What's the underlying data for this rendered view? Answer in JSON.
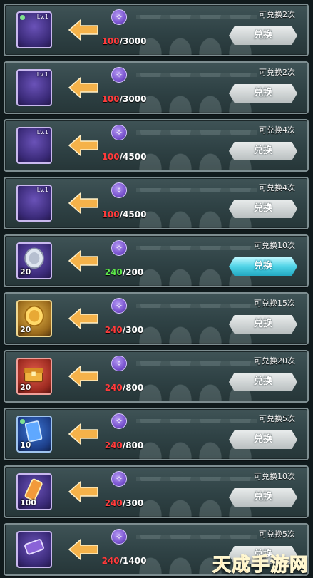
{
  "rows": [
    {
      "level": "Lv.1",
      "quantity": "",
      "have": "100",
      "need": "3000",
      "enough": false,
      "remaining": "可兑换2次",
      "button": "兑换",
      "active": false,
      "icon": "hero-portrait-icon",
      "color": "purple"
    },
    {
      "level": "Lv.1",
      "quantity": "",
      "have": "100",
      "need": "3000",
      "enough": false,
      "remaining": "可兑换2次",
      "button": "兑换",
      "active": false,
      "icon": "hero-portrait-icon",
      "color": "purple"
    },
    {
      "level": "Lv.1",
      "quantity": "",
      "have": "100",
      "need": "4500",
      "enough": false,
      "remaining": "可兑换4次",
      "button": "兑换",
      "active": false,
      "icon": "hero-portrait-icon",
      "color": "purple"
    },
    {
      "level": "Lv.1",
      "quantity": "",
      "have": "100",
      "need": "4500",
      "enough": false,
      "remaining": "可兑换4次",
      "button": "兑换",
      "active": false,
      "icon": "hero-portrait-icon",
      "color": "purple"
    },
    {
      "level": "",
      "quantity": "20",
      "have": "240",
      "need": "200",
      "enough": true,
      "remaining": "可兑换10次",
      "button": "兑换",
      "active": true,
      "icon": "silver-coin-icon",
      "color": "purple"
    },
    {
      "level": "",
      "quantity": "20",
      "have": "240",
      "need": "300",
      "enough": false,
      "remaining": "可兑换15次",
      "button": "兑换",
      "active": false,
      "icon": "gold-coin-icon",
      "color": "gold"
    },
    {
      "level": "",
      "quantity": "20",
      "have": "240",
      "need": "800",
      "enough": false,
      "remaining": "可兑换20次",
      "button": "兑换",
      "active": false,
      "icon": "treasure-chest-icon",
      "color": "red"
    },
    {
      "level": "",
      "quantity": "10",
      "have": "240",
      "need": "800",
      "enough": false,
      "remaining": "可兑换5次",
      "button": "兑换",
      "active": false,
      "icon": "blue-card-icon",
      "color": "blue"
    },
    {
      "level": "",
      "quantity": "100",
      "have": "240",
      "need": "300",
      "enough": false,
      "remaining": "可兑换10次",
      "button": "兑换",
      "active": false,
      "icon": "scroll-icon",
      "color": "purple"
    },
    {
      "level": "",
      "quantity": "",
      "have": "240",
      "need": "1400",
      "enough": false,
      "remaining": "可兑换5次",
      "button": "兑换",
      "active": false,
      "icon": "scroll-icon",
      "color": "purple"
    }
  ],
  "watermark": "天成手游网"
}
